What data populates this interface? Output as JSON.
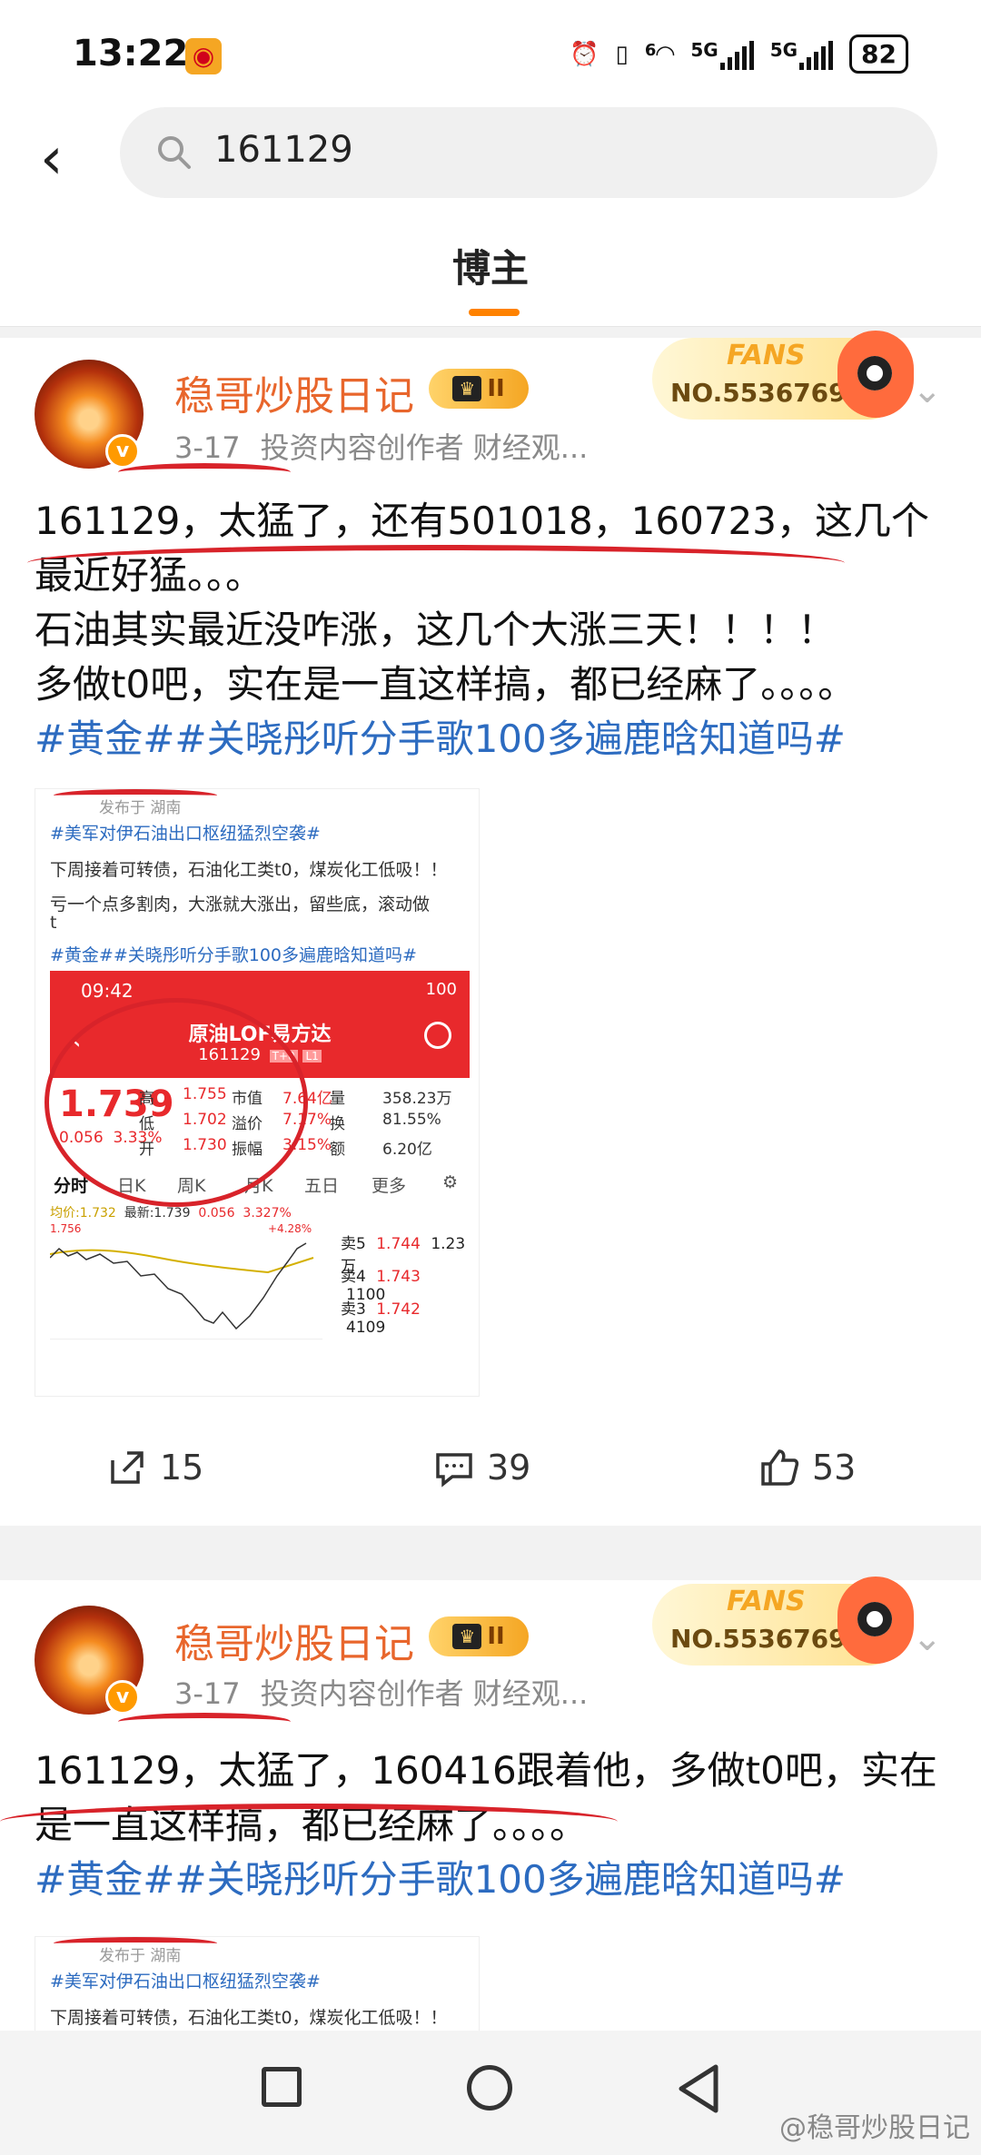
{
  "status": {
    "time": "13:22",
    "battery": "82",
    "net1": "5G",
    "net2": "5G",
    "wifi": "6"
  },
  "search": {
    "query": "161129"
  },
  "tabs": {
    "active": "博主"
  },
  "posts": [
    {
      "user": "稳哥炒股日记",
      "vip_level": "II",
      "date": "3-17",
      "role": "投资内容创作者 财经观...",
      "fans_label": "FANS",
      "fans_no": "NO.5536769",
      "lines": [
        "161129，太猛了，还有501018，160723，这几个最近好猛。。。",
        "石油其实最近没咋涨，这几个大涨三天！！！！",
        "多做t0吧，实在是一直这样搞，都已经麻了。。。。"
      ],
      "topics": "#黄金##关晓彤听分手歌100多遍鹿晗知道吗#",
      "thumb": {
        "posted_from": "发布于 湖南",
        "topic1": "#美军对伊石油出口枢纽猛烈空袭#",
        "line1": "下周接着可转债，石油化工类t0，煤炭化工低吸！！",
        "line2": "亏一个点多割肉，大涨就大涨出，留些底，滚动做",
        "line2b": "t",
        "topic2": "#黄金##关晓彤听分手歌100多遍鹿晗知道吗#",
        "quote": {
          "time": "09:42",
          "status": "100",
          "name": "原油LOF易方达",
          "code": "161129",
          "tag1": "T+0",
          "tag2": "L1",
          "price": "1.739",
          "chg": "0.056",
          "chg_pct": "3.33%",
          "rows": [
            [
              "高",
              "1.755",
              "市值",
              "7.64亿",
              "量",
              "358.23万"
            ],
            [
              "低",
              "1.702",
              "溢价",
              "7.17%",
              "换",
              "81.55%"
            ],
            [
              "开",
              "1.730",
              "振幅",
              "3.15%",
              "额",
              "6.20亿"
            ]
          ],
          "tabs": [
            "分时",
            "日K",
            "周K",
            "月K",
            "五日",
            "更多"
          ],
          "avg_label": "均价:1.732",
          "latest_label": "最新:1.739",
          "latest_chg": "0.056",
          "latest_pct": "3.327%",
          "chart_high": "1.756",
          "chart_pct": "+4.28%",
          "book": [
            [
              "卖5",
              "1.744",
              "1.23万"
            ],
            [
              "卖4",
              "1.743",
              "1100"
            ],
            [
              "卖3",
              "1.742",
              "4109"
            ]
          ]
        }
      },
      "repost": "15",
      "comment": "39",
      "like": "53"
    },
    {
      "user": "稳哥炒股日记",
      "vip_level": "II",
      "date": "3-17",
      "role": "投资内容创作者 财经观...",
      "fans_label": "FANS",
      "fans_no": "NO.5536769",
      "lines": [
        "161129，太猛了，160416跟着他，多做t0吧，实在是一直这样搞，都已经麻了。。。。"
      ],
      "topics": "#黄金##关晓彤听分手歌100多遍鹿晗知道吗#",
      "thumb": {
        "posted_from": "发布于 湖南",
        "topic1": "#美军对伊石油出口枢纽猛烈空袭#",
        "line1": "下周接着可转债，石油化工类t0，煤炭化工低吸！！"
      }
    }
  ],
  "watermark": "@稳哥炒股日记",
  "colors": {
    "accent": "#ff8200",
    "username": "#e8662c",
    "topic": "#2c6bc0",
    "annotation": "#d8232a",
    "quote_red": "#e8292c"
  }
}
